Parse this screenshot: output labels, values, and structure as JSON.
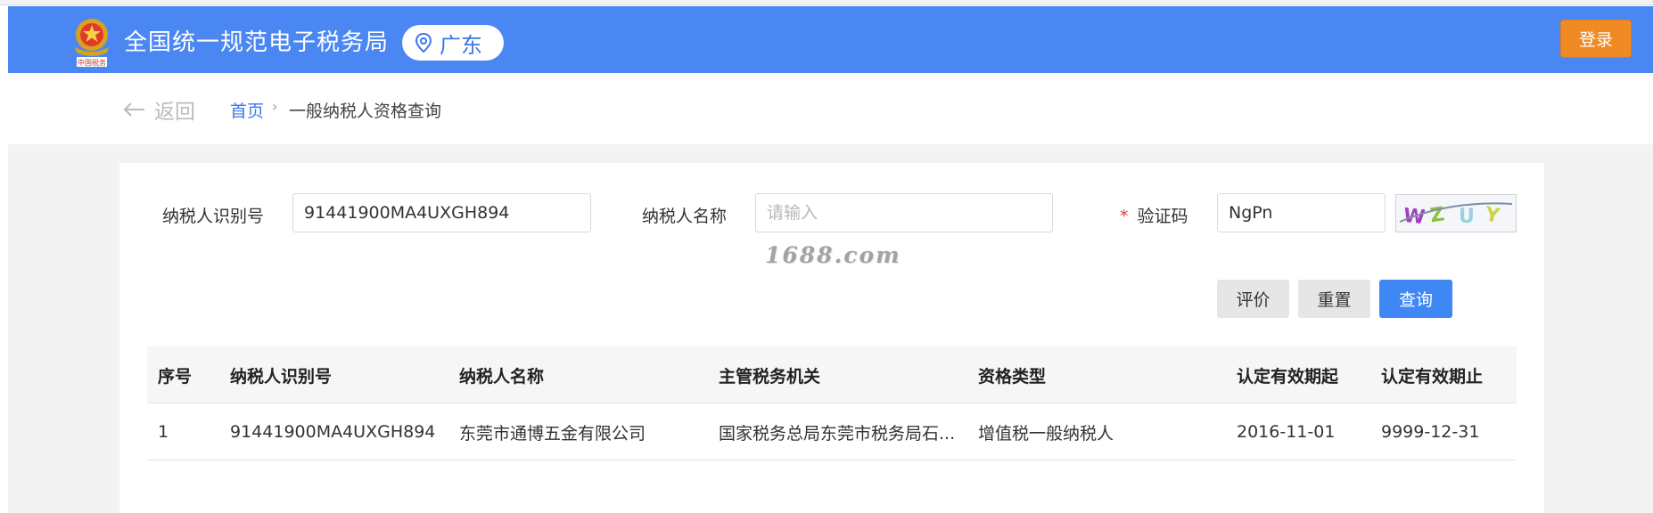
{
  "header": {
    "title": "全国统一规范电子税务局",
    "region": "广东",
    "login_label": "登录",
    "bg_color": "#4a87f2"
  },
  "breadcrumb": {
    "back_label": "返回",
    "home": "首页",
    "separator": "›",
    "current": "一般纳税人资格查询"
  },
  "form": {
    "taxpayer_id_label": "纳税人识别号",
    "taxpayer_id_value": "91441900MA4UXGH894",
    "taxpayer_name_label": "纳税人名称",
    "taxpayer_name_placeholder": "请输入",
    "captcha_star": "*",
    "captcha_label": "验证码",
    "captcha_value": "NgPn",
    "captcha_image_text": "WZUY"
  },
  "watermark": "1688.com",
  "buttons": {
    "evaluate": "评价",
    "reset": "重置",
    "query": "查询"
  },
  "table": {
    "columns": [
      "序号",
      "纳税人识别号",
      "纳税人名称",
      "主管税务机关",
      "资格类型",
      "认定有效期起",
      "认定有效期止"
    ],
    "rows": [
      [
        "1",
        "91441900MA4UXGH894",
        "东莞市通博五金有限公司",
        "国家税务总局东莞市税务局石...",
        "增值税一般纳税人",
        "2016-11-01",
        "9999-12-31"
      ]
    ]
  },
  "colors": {
    "primary": "#3f87f5",
    "login": "#f08a24",
    "required": "#e03c3c"
  }
}
